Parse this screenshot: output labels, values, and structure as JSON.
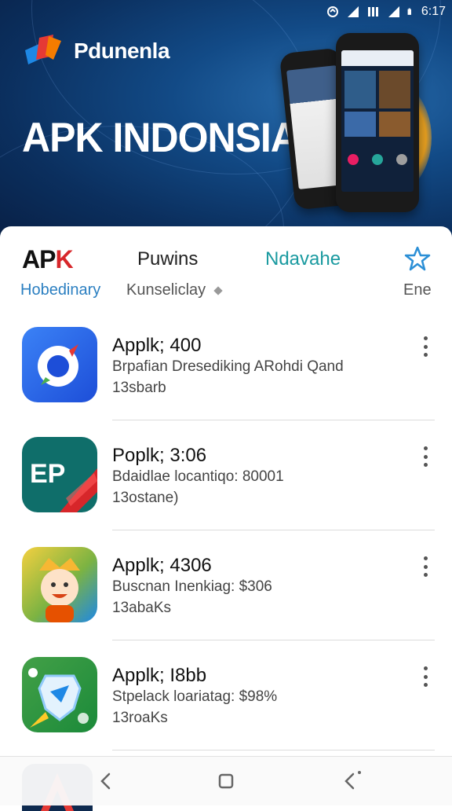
{
  "status_bar": {
    "time": "6:17"
  },
  "hero": {
    "brand_name": "Pdunenla",
    "title": "APK INDONSIA"
  },
  "tabs": [
    {
      "top": "APK",
      "sub": "Hobedinary"
    },
    {
      "top": "Puwins",
      "sub": "Kunseliclay"
    },
    {
      "top": "Ndavahe",
      "sub": ""
    },
    {
      "top": "",
      "sub": "Ene"
    }
  ],
  "apps": [
    {
      "title": "Applk; 400",
      "desc": "Brpafian Dresediking ARohdi Qand",
      "meta": "13sbarb",
      "icon": "compass-chat-icon"
    },
    {
      "title": "Poplk; 3:06",
      "desc": "Bdaidlae locantiqo: 80001",
      "meta": "13ostane)",
      "icon": "ep-ribbon-icon"
    },
    {
      "title": "Applk; 4306",
      "desc": "Buscnan Inenkiag: $306",
      "meta": "13abaKs",
      "icon": "cartoon-character-icon"
    },
    {
      "title": "Applk; I8bb",
      "desc": "Stpelack loariatag: $98%",
      "meta": "13roaKs",
      "icon": "shield-bird-icon"
    }
  ],
  "colors": {
    "accent": "#1a9aa0",
    "brand_red": "#d7262a",
    "link_blue": "#2b7fc1"
  }
}
